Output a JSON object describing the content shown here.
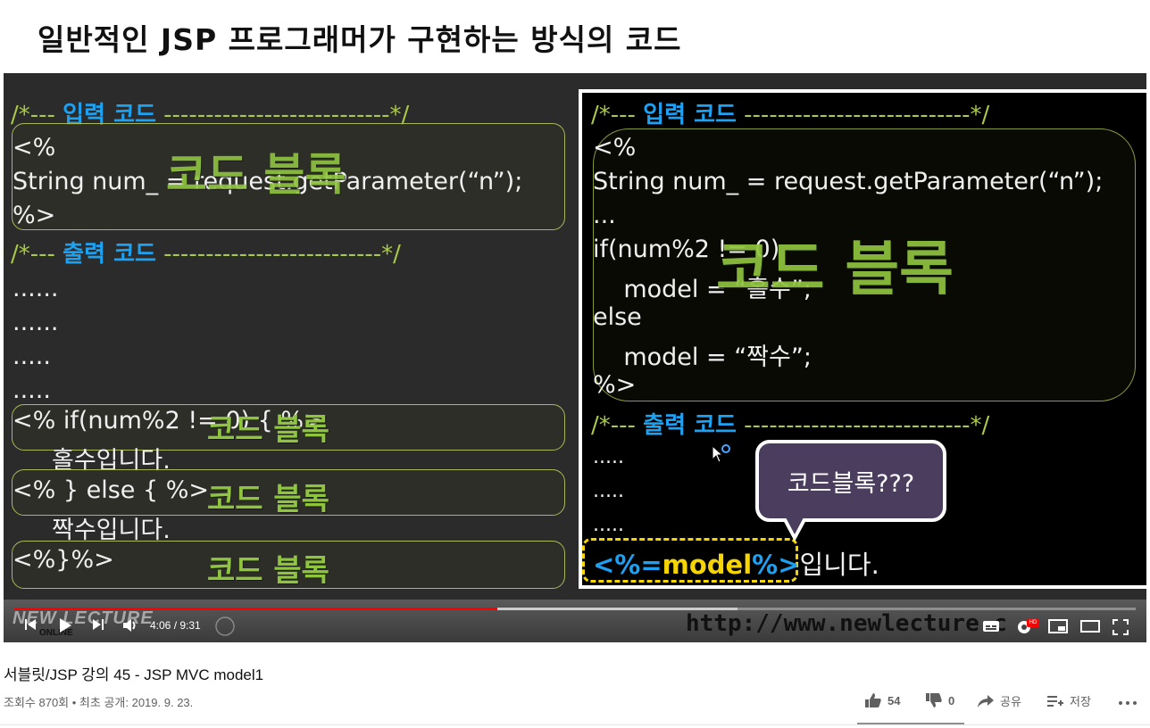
{
  "slide": {
    "title": "일반적인 JSP 프로그래머가 구현하는 방식의 코드",
    "left": {
      "input_comment": {
        "prefix": "/*---",
        "keyword": "입력 코드",
        "suffix": "---------------------------*/"
      },
      "input_lines": [
        "<%",
        "String num_ = request.getParameter(“n”);",
        "%>"
      ],
      "input_block_label": "코드 블록",
      "output_comment": {
        "prefix": "/*---",
        "keyword": "출력 코드",
        "suffix": "--------------------------*/"
      },
      "dots": [
        "......",
        "......",
        ".....",
        "....."
      ],
      "if_line": "<% if(num%2 != 0) { %>",
      "if_block_label": "코드 블록",
      "odd_text": "홀수입니다.",
      "else_line": "<% } else { %>",
      "else_block_label": "코드 블록",
      "even_text": "짝수입니다.",
      "close_line": "<%}%>",
      "close_block_label": "코드 블록"
    },
    "right": {
      "input_comment": {
        "prefix": "/*---",
        "keyword": "입력 코드",
        "suffix": "---------------------------*/"
      },
      "code_lines": [
        "<%",
        "String num_ = request.getParameter(“n”);",
        "...",
        "if(num%2 != 0)",
        "    model = “홀수”;",
        "else",
        "    model = “짝수”;",
        "%>"
      ],
      "block_label": "코드 블록",
      "output_comment": {
        "prefix": "/*---",
        "keyword": "출력 코드",
        "suffix": "---------------------------*/"
      },
      "dots": [
        ".....",
        ".....",
        "....."
      ],
      "expr_open": "<%=",
      "expr_model": "model",
      "expr_close": "%>",
      "expr_after": "입니다.",
      "bubble": "코드블록???"
    },
    "watermark_url": "http://www.newlecture.c",
    "logo_text": "NEW LECTURE",
    "logo_sub": "ONLINE"
  },
  "player": {
    "current_time": "4:06",
    "duration": "9:31",
    "time_sep": " / ",
    "played_fraction": 0.431,
    "hd_badge": "HD"
  },
  "video": {
    "title": "서블릿/JSP 강의 45 - JSP MVC model1",
    "meta": "조회수 870회 • 최초 공개: 2019. 9. 23.",
    "likes": "54",
    "dislikes": "0",
    "share_label": "공유",
    "save_label": "저장"
  }
}
